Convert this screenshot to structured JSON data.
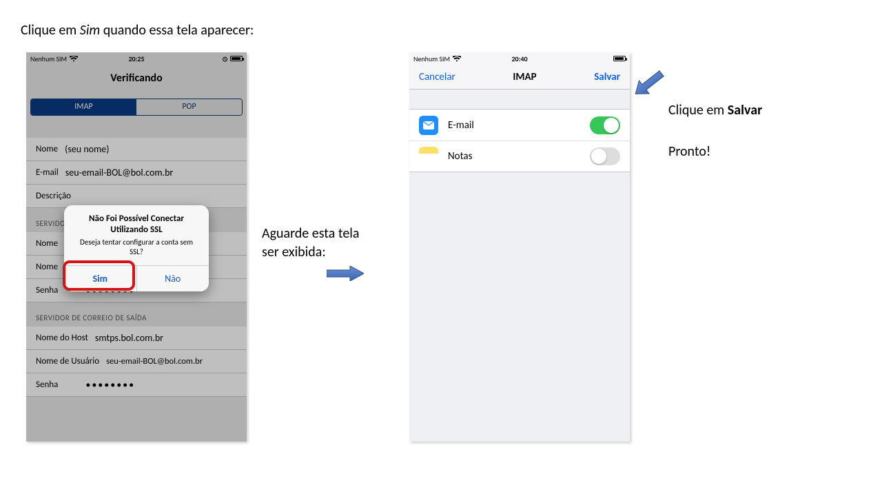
{
  "instructions": {
    "top_prefix": "Clique em ",
    "top_italic": "Sim ",
    "top_suffix": "quando essa tela aparecer:",
    "mid_line1": "Aguarde esta tela",
    "mid_line2": "ser exibida:",
    "right1_prefix": "Clique em ",
    "right1_bold": "Salvar",
    "right2": "Pronto!"
  },
  "phone1": {
    "carrier": "Nenhum SIM",
    "time": "20:25",
    "title": "Verificando",
    "seg_imap": "IMAP",
    "seg_pop": "POP",
    "row_nome_label": "Nome",
    "row_nome_value": "(seu nome)",
    "row_email_label": "E-mail",
    "row_email_value": "seu-email-BOL@bol.com.br",
    "row_desc_label": "Descrição",
    "section_in": "SERVIDOR",
    "in_host_label": "Nome",
    "in_user_label": "Nome",
    "in_pass_label": "Senha",
    "in_pass_value": "••••••••",
    "section_out": "SERVIDOR DE CORREIO DE SAÍDA",
    "out_host_label": "Nome do Host",
    "out_host_value": "smtps.bol.com.br",
    "out_user_label": "Nome de Usuário",
    "out_user_value": "seu-email-BOL@bol.com.br",
    "out_pass_label": "Senha",
    "out_pass_value": "••••••••",
    "dialog_title": "Não Foi Possível Conectar Utilizando SSL",
    "dialog_msg": "Deseja tentar configurar a conta sem SSL?",
    "dialog_yes": "Sim",
    "dialog_no": "Não"
  },
  "phone2": {
    "carrier": "Nenhum SIM",
    "time": "20:40",
    "nav_cancel": "Cancelar",
    "nav_title": "IMAP",
    "nav_save": "Salvar",
    "svc_mail": "E-mail",
    "svc_notes": "Notas"
  }
}
